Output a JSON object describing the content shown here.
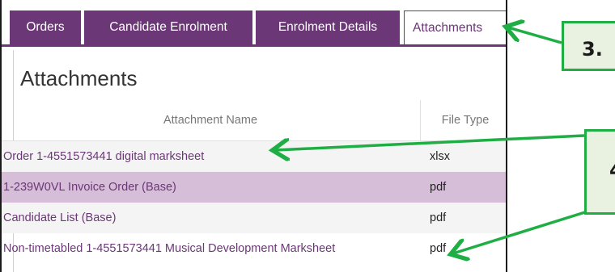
{
  "tabs": [
    {
      "label": "Orders"
    },
    {
      "label": "Candidate Enrolment"
    },
    {
      "label": "Enrolment Details"
    },
    {
      "label": "Attachments"
    }
  ],
  "panel": {
    "title": "Attachments"
  },
  "table": {
    "columns": [
      "Attachment Name",
      "File Type"
    ],
    "rows": [
      {
        "name": "Order 1-4551573441 digital marksheet",
        "type": "xlsx"
      },
      {
        "name": "1-239W0VL Invoice Order (Base)",
        "type": "pdf"
      },
      {
        "name": "Candidate List (Base)",
        "type": "pdf"
      },
      {
        "name": "Non-timetabled 1-4551573441 Musical Development Marksheet",
        "type": "pdf"
      }
    ]
  },
  "callouts": {
    "step3": "3.",
    "step4": "4"
  },
  "colors": {
    "tab_purple": "#6b3777",
    "selected_row": "#d7bed8",
    "callout_green": "#1fae43",
    "callout_fill": "#e9f2e1"
  }
}
